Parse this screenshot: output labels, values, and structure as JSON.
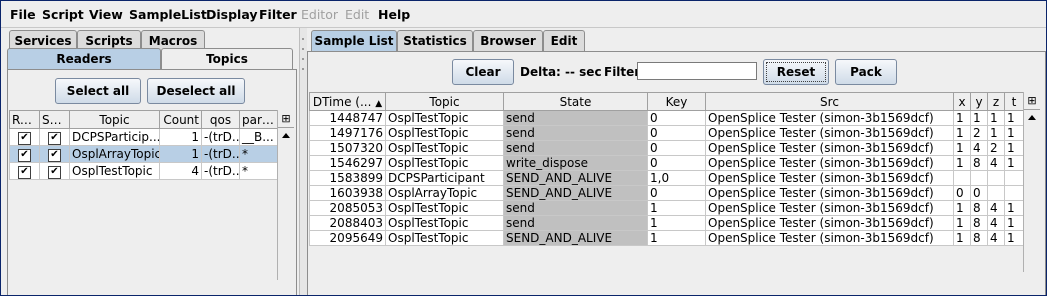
{
  "menubar": {
    "items": [
      {
        "label": "File",
        "enabled": true
      },
      {
        "label": "Script",
        "enabled": true
      },
      {
        "label": "View",
        "enabled": true
      },
      {
        "label": "SampleList",
        "enabled": true
      },
      {
        "label": "Display",
        "enabled": true
      },
      {
        "label": "Filter",
        "enabled": true
      },
      {
        "label": "Editor",
        "enabled": false
      },
      {
        "label": "Edit",
        "enabled": false
      },
      {
        "label": "Help",
        "enabled": true
      }
    ]
  },
  "left": {
    "tabs_row1": [
      "Services",
      "Scripts",
      "Macros"
    ],
    "tabs_row2": [
      "Readers",
      "Topics"
    ],
    "select_all_label": "Select all",
    "deselect_all_label": "Deselect all",
    "columns": [
      "Read",
      "Sh...",
      "Topic",
      "Count",
      "qos",
      "parti..."
    ],
    "rows": [
      {
        "read": true,
        "sh": true,
        "topic": "DCPSParticip...",
        "count": "1",
        "qos": "-(trD...",
        "parti": "__B..."
      },
      {
        "read": true,
        "sh": true,
        "topic": "OsplArrayTopic",
        "count": "1",
        "qos": "-(trD...",
        "parti": "*"
      },
      {
        "read": true,
        "sh": true,
        "topic": "OsplTestTopic",
        "count": "4",
        "qos": "-(trD...",
        "parti": "*"
      }
    ],
    "selected_row": 1
  },
  "right": {
    "tabs": [
      "Sample List",
      "Statistics",
      "Browser",
      "Edit"
    ],
    "clear_label": "Clear",
    "delta_label": "Delta: -- sec",
    "filter_label": "Filter",
    "filter_value": "",
    "reset_label": "Reset",
    "pack_label": "Pack",
    "columns": [
      "DTime (...",
      "Topic",
      "State",
      "Key",
      "Src",
      "x",
      "y",
      "z",
      "t"
    ],
    "sort_indicator": "▲",
    "rows": [
      {
        "dtime": "1448747",
        "topic": "OsplTestTopic",
        "state": "send",
        "key": "0",
        "src": "OpenSplice Tester (simon-3b1569dcf)",
        "x": "1",
        "y": "1",
        "z": "1",
        "t": "1"
      },
      {
        "dtime": "1497176",
        "topic": "OsplTestTopic",
        "state": "send",
        "key": "0",
        "src": "OpenSplice Tester (simon-3b1569dcf)",
        "x": "1",
        "y": "2",
        "z": "1",
        "t": "1"
      },
      {
        "dtime": "1507320",
        "topic": "OsplTestTopic",
        "state": "send",
        "key": "0",
        "src": "OpenSplice Tester (simon-3b1569dcf)",
        "x": "1",
        "y": "4",
        "z": "2",
        "t": "1"
      },
      {
        "dtime": "1546297",
        "topic": "OsplTestTopic",
        "state": "write_dispose",
        "key": "0",
        "src": "OpenSplice Tester (simon-3b1569dcf)",
        "x": "1",
        "y": "8",
        "z": "4",
        "t": "1"
      },
      {
        "dtime": "1583899",
        "topic": "DCPSParticipant",
        "state": "SEND_AND_ALIVE",
        "key": "1,0",
        "src": "OpenSplice Tester (simon-3b1569dcf)",
        "x": "",
        "y": "",
        "z": "",
        "t": ""
      },
      {
        "dtime": "1603938",
        "topic": "OsplArrayTopic",
        "state": "SEND_AND_ALIVE",
        "key": "0",
        "src": "OpenSplice Tester (simon-3b1569dcf)",
        "x": "0",
        "y": "0",
        "z": "",
        "t": ""
      },
      {
        "dtime": "2085053",
        "topic": "OsplTestTopic",
        "state": "send",
        "key": "1",
        "src": "OpenSplice Tester (simon-3b1569dcf)",
        "x": "1",
        "y": "8",
        "z": "4",
        "t": "1"
      },
      {
        "dtime": "2088403",
        "topic": "OsplTestTopic",
        "state": "send",
        "key": "1",
        "src": "OpenSplice Tester (simon-3b1569dcf)",
        "x": "1",
        "y": "8",
        "z": "4",
        "t": "1"
      },
      {
        "dtime": "2095649",
        "topic": "OsplTestTopic",
        "state": "SEND_AND_ALIVE",
        "key": "1",
        "src": "OpenSplice Tester (simon-3b1569dcf)",
        "x": "1",
        "y": "8",
        "z": "4",
        "t": "1"
      }
    ]
  },
  "icons": {
    "column_chooser": "table-columns-icon",
    "scroll_up": "arrow-up-icon",
    "check": "checkmark-icon"
  }
}
